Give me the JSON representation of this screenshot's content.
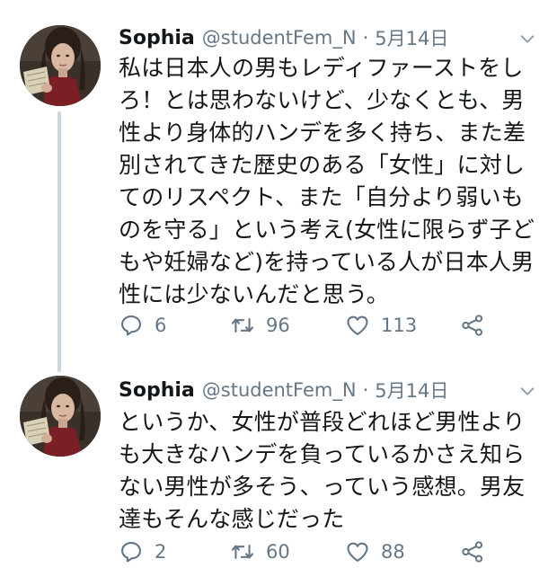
{
  "tweets": [
    {
      "display_name": "Sophia",
      "handle": "@studentFem_N",
      "separator": "·",
      "date": "5月14日",
      "text": "私は日本人の男もレディファーストをしろ！とは思わないけど、少なくとも、男性より身体的ハンデを多く持ち、また差別されてきた歴史のある「女性」に対してのリスペクト、また「自分より弱いものを守る」という考え(女性に限らず子どもや妊婦など)を持っている人が日本人男性には少ないんだと思う。",
      "replies": "6",
      "retweets": "96",
      "likes": "113"
    },
    {
      "display_name": "Sophia",
      "handle": "@studentFem_N",
      "separator": "·",
      "date": "5月14日",
      "text": "というか、女性が普段どれほど男性よりも大きなハンデを負っているかさえ知らない男性が多そう、っていう感想。男友達もそんな感じだった",
      "replies": "2",
      "retweets": "60",
      "likes": "88"
    }
  ],
  "icons": {
    "reply": "reply-icon",
    "retweet": "retweet-icon",
    "like": "heart-icon",
    "share": "share-icon",
    "menu": "chevron-down-icon"
  },
  "colors": {
    "text": "#14171a",
    "secondary": "#657786",
    "thread_line": "#ccd6dd",
    "background": "#ffffff"
  }
}
